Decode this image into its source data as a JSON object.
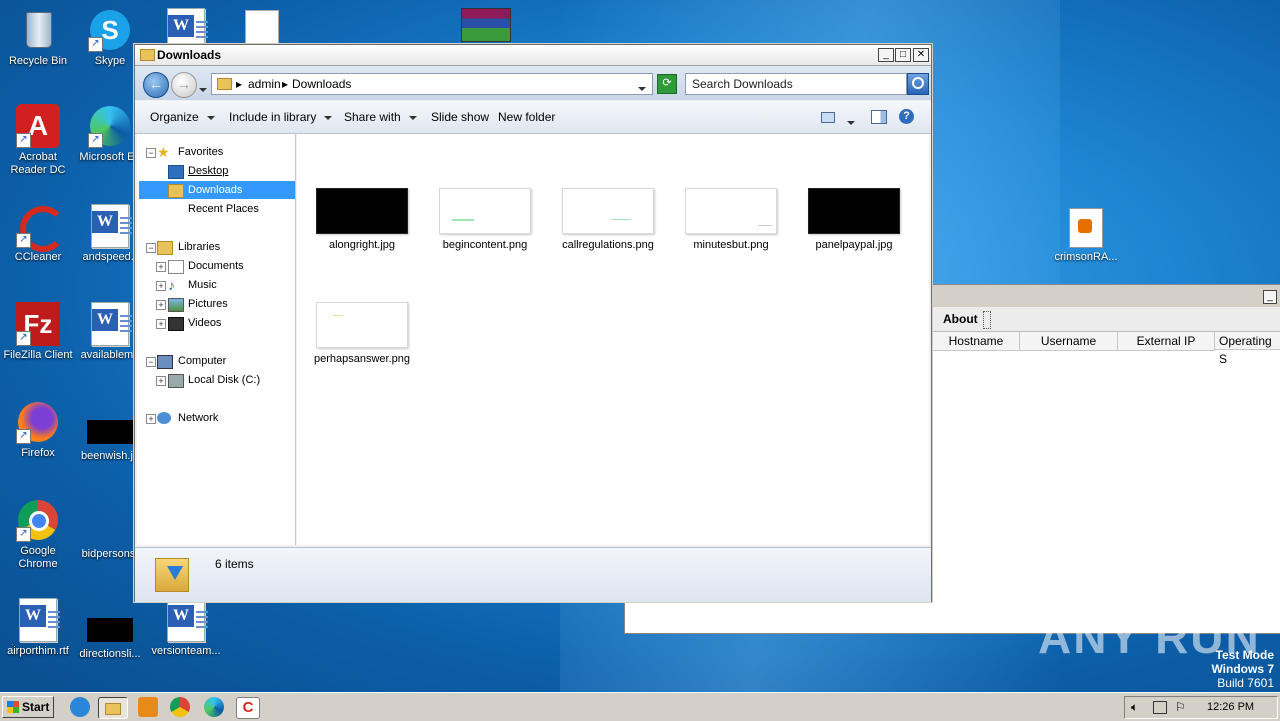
{
  "desktop": {
    "icons": [
      {
        "label": "Recycle Bin"
      },
      {
        "label": "Skype"
      },
      {
        "label": "Acrobat Reader DC"
      },
      {
        "label": "Microsoft Ed"
      },
      {
        "label": "CCleaner"
      },
      {
        "label": "andspeed.r"
      },
      {
        "label": "FileZilla Client"
      },
      {
        "label": "availablema"
      },
      {
        "label": "Firefox"
      },
      {
        "label": "beenwish.jp"
      },
      {
        "label": "Google Chrome"
      },
      {
        "label": "bidpersons."
      },
      {
        "label": "airporthim.rtf"
      },
      {
        "label": "directionsli..."
      },
      {
        "label": "versionteam..."
      },
      {
        "label": "crimsonRA..."
      }
    ]
  },
  "explorer": {
    "title": "Downloads",
    "breadcrumb": [
      "admin",
      "Downloads"
    ],
    "search_placeholder": "Search Downloads",
    "toolbar": {
      "organize": "Organize",
      "include_in_library": "Include in library",
      "share_with": "Share with",
      "slide_show": "Slide show",
      "new_folder": "New folder"
    },
    "nav": {
      "favorites": "Favorites",
      "desktop": "Desktop",
      "downloads": "Downloads",
      "recent_places": "Recent Places",
      "libraries": "Libraries",
      "documents": "Documents",
      "music": "Music",
      "pictures": "Pictures",
      "videos": "Videos",
      "computer": "Computer",
      "local_disk": "Local Disk (C:)",
      "network": "Network"
    },
    "files": [
      {
        "name": "alongright.jpg",
        "dark": true
      },
      {
        "name": "begincontent.png",
        "dark": false
      },
      {
        "name": "callregulations.png",
        "dark": false
      },
      {
        "name": "minutesbut.png",
        "dark": false
      },
      {
        "name": "panelpaypal.jpg",
        "dark": true
      },
      {
        "name": "perhapsanswer.png",
        "dark": false
      }
    ],
    "status": "6 items"
  },
  "app_window": {
    "tab": "About",
    "columns": [
      "Hostname",
      "Username",
      "External IP",
      "Operating S"
    ]
  },
  "watermark": {
    "line1": "Test Mode",
    "line2": "Windows 7",
    "line3": "Build 7601",
    "brand": "ANY RUN"
  },
  "taskbar": {
    "start": "Start",
    "clock": "12:26 PM"
  },
  "colors": {
    "selection": "#3399ff",
    "desktop": "#1c84d2",
    "taskbar": "#d4d0c8"
  }
}
